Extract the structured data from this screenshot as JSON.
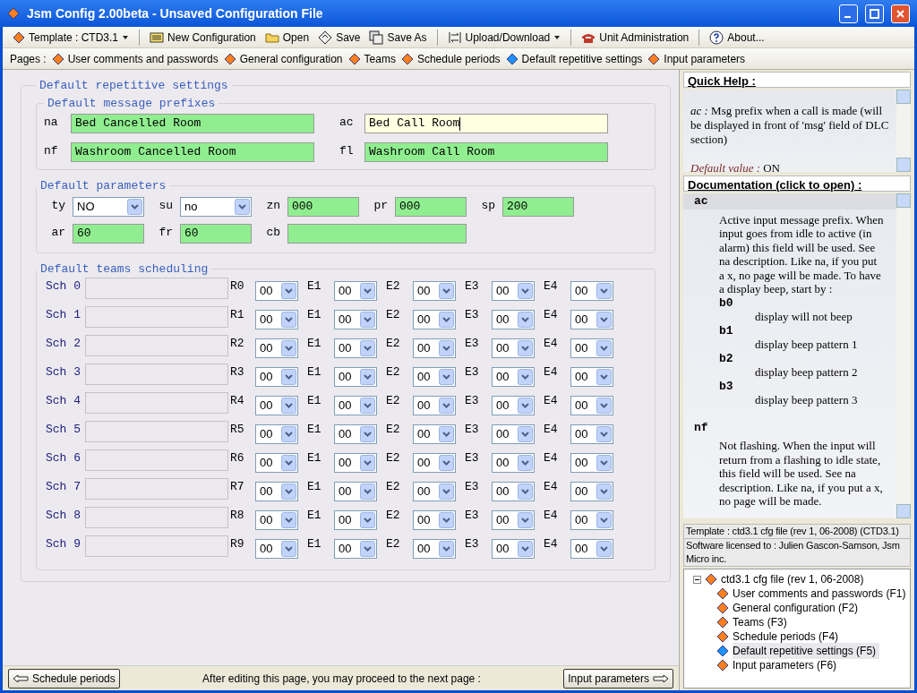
{
  "window": {
    "title": "Jsm Config 2.00beta - Unsaved Configuration File"
  },
  "toolbar": [
    {
      "kind": "template",
      "label": "Template : CTD3.1"
    },
    {
      "kind": "new",
      "label": "New Configuration"
    },
    {
      "kind": "open",
      "label": "Open"
    },
    {
      "kind": "save",
      "label": "Save"
    },
    {
      "kind": "saveas",
      "label": "Save As"
    },
    {
      "kind": "upload",
      "label": "Upload/Download"
    },
    {
      "kind": "unit",
      "label": "Unit Administration"
    },
    {
      "kind": "about",
      "label": "About..."
    }
  ],
  "pages": {
    "label": "Pages :",
    "items": [
      {
        "label": "User comments and passwords",
        "selected": false
      },
      {
        "label": "General configuration",
        "selected": false
      },
      {
        "label": "Teams",
        "selected": false
      },
      {
        "label": "Schedule periods",
        "selected": false
      },
      {
        "label": "Default repetitive settings",
        "selected": true
      },
      {
        "label": "Input parameters",
        "selected": false
      }
    ]
  },
  "main": {
    "title": "Default repetitive settings",
    "prefixes": {
      "title": "Default message prefixes",
      "fields": [
        {
          "label": "na",
          "value": "Bed Cancelled Room",
          "focused": false
        },
        {
          "label": "ac",
          "value": "Bed Call Room",
          "focused": true
        },
        {
          "label": "nf",
          "value": "Washroom Cancelled Room",
          "focused": false
        },
        {
          "label": "fl",
          "value": "Washroom Call Room",
          "focused": false
        }
      ]
    },
    "parameters": {
      "title": "Default parameters",
      "fields": [
        {
          "kind": "select",
          "label": "ty",
          "value": "NO"
        },
        {
          "kind": "select",
          "label": "su",
          "value": "no"
        },
        {
          "kind": "text",
          "label": "zn",
          "value": "000"
        },
        {
          "kind": "text",
          "label": "pr",
          "value": "000"
        },
        {
          "kind": "text",
          "label": "sp",
          "value": "200"
        },
        {
          "kind": "text",
          "label": "ar",
          "value": "60"
        },
        {
          "kind": "text",
          "label": "fr",
          "value": "60"
        },
        {
          "kind": "wide",
          "label": "cb"
        }
      ]
    },
    "scheduling": {
      "title": "Default teams scheduling",
      "rows": [
        {
          "label": "Sch 0",
          "slots": [
            {
              "label": "R0",
              "value": "00"
            },
            {
              "label": "E1",
              "value": "00"
            },
            {
              "label": "E2",
              "value": "00"
            },
            {
              "label": "E3",
              "value": "00"
            },
            {
              "label": "E4",
              "value": "00"
            }
          ]
        },
        {
          "label": "Sch 1",
          "slots": [
            {
              "label": "R1",
              "value": "00"
            },
            {
              "label": "E1",
              "value": "00"
            },
            {
              "label": "E2",
              "value": "00"
            },
            {
              "label": "E3",
              "value": "00"
            },
            {
              "label": "E4",
              "value": "00"
            }
          ]
        },
        {
          "label": "Sch 2",
          "slots": [
            {
              "label": "R2",
              "value": "00"
            },
            {
              "label": "E1",
              "value": "00"
            },
            {
              "label": "E2",
              "value": "00"
            },
            {
              "label": "E3",
              "value": "00"
            },
            {
              "label": "E4",
              "value": "00"
            }
          ]
        },
        {
          "label": "Sch 3",
          "slots": [
            {
              "label": "R3",
              "value": "00"
            },
            {
              "label": "E1",
              "value": "00"
            },
            {
              "label": "E2",
              "value": "00"
            },
            {
              "label": "E3",
              "value": "00"
            },
            {
              "label": "E4",
              "value": "00"
            }
          ]
        },
        {
          "label": "Sch 4",
          "slots": [
            {
              "label": "R4",
              "value": "00"
            },
            {
              "label": "E1",
              "value": "00"
            },
            {
              "label": "E2",
              "value": "00"
            },
            {
              "label": "E3",
              "value": "00"
            },
            {
              "label": "E4",
              "value": "00"
            }
          ]
        },
        {
          "label": "Sch 5",
          "slots": [
            {
              "label": "R5",
              "value": "00"
            },
            {
              "label": "E1",
              "value": "00"
            },
            {
              "label": "E2",
              "value": "00"
            },
            {
              "label": "E3",
              "value": "00"
            },
            {
              "label": "E4",
              "value": "00"
            }
          ]
        },
        {
          "label": "Sch 6",
          "slots": [
            {
              "label": "R6",
              "value": "00"
            },
            {
              "label": "E1",
              "value": "00"
            },
            {
              "label": "E2",
              "value": "00"
            },
            {
              "label": "E3",
              "value": "00"
            },
            {
              "label": "E4",
              "value": "00"
            }
          ]
        },
        {
          "label": "Sch 7",
          "slots": [
            {
              "label": "R7",
              "value": "00"
            },
            {
              "label": "E1",
              "value": "00"
            },
            {
              "label": "E2",
              "value": "00"
            },
            {
              "label": "E3",
              "value": "00"
            },
            {
              "label": "E4",
              "value": "00"
            }
          ]
        },
        {
          "label": "Sch 8",
          "slots": [
            {
              "label": "R8",
              "value": "00"
            },
            {
              "label": "E1",
              "value": "00"
            },
            {
              "label": "E2",
              "value": "00"
            },
            {
              "label": "E3",
              "value": "00"
            },
            {
              "label": "E4",
              "value": "00"
            }
          ]
        },
        {
          "label": "Sch 9",
          "slots": [
            {
              "label": "R9",
              "value": "00"
            },
            {
              "label": "E1",
              "value": "00"
            },
            {
              "label": "E2",
              "value": "00"
            },
            {
              "label": "E3",
              "value": "00"
            },
            {
              "label": "E4",
              "value": "00"
            }
          ]
        }
      ]
    }
  },
  "footer": {
    "prev": "Schedule periods",
    "note": "After editing this page, you may proceed to the next page :",
    "next": "Input parameters"
  },
  "quick_help": {
    "title": "Quick Help :",
    "text": "*ac :* Msg prefix when a call is made (will be displayed in front of 'msg' field of DLC section)",
    "default_label": "Default value :",
    "default_value": "ON"
  },
  "documentation": {
    "title": "Documentation (click to open) :",
    "entries": [
      {
        "term": "ac",
        "text": "Active input message prefix. When input goes from idle to active (in alarm) this field will be used. See na description. Like na, if you put a x, no page will be made. To have a display beep, start by :",
        "options": [
          {
            "code": "b0",
            "text": "display will not beep"
          },
          {
            "code": "b1",
            "text": "display beep pattern 1"
          },
          {
            "code": "b2",
            "text": "display beep pattern 2"
          },
          {
            "code": "b3",
            "text": "display beep pattern 3"
          }
        ]
      },
      {
        "term": "nf",
        "text": "Not flashing. When the input will return from a flashing to idle state, this field will be used. See na description. Like na, if you put a x, no page will be made."
      }
    ]
  },
  "info": {
    "template": "Template : ctd3.1 cfg file (rev 1, 06-2008) (CTD3.1)",
    "license": "Software licensed to : Julien Gascon-Samson, Jsm Micro inc."
  },
  "tree": {
    "label": "ctd3.1 cfg file (rev 1, 06-2008)",
    "expanded": true,
    "children": [
      {
        "label": "User comments and passwords (F1)",
        "selected": false
      },
      {
        "label": "General configuration (F2)",
        "selected": false
      },
      {
        "label": "Teams (F3)",
        "selected": false
      },
      {
        "label": "Schedule periods (F4)",
        "selected": false
      },
      {
        "label": "Default repetitive settings (F5)",
        "selected": true
      },
      {
        "label": "Input parameters (F6)",
        "selected": false
      }
    ]
  }
}
